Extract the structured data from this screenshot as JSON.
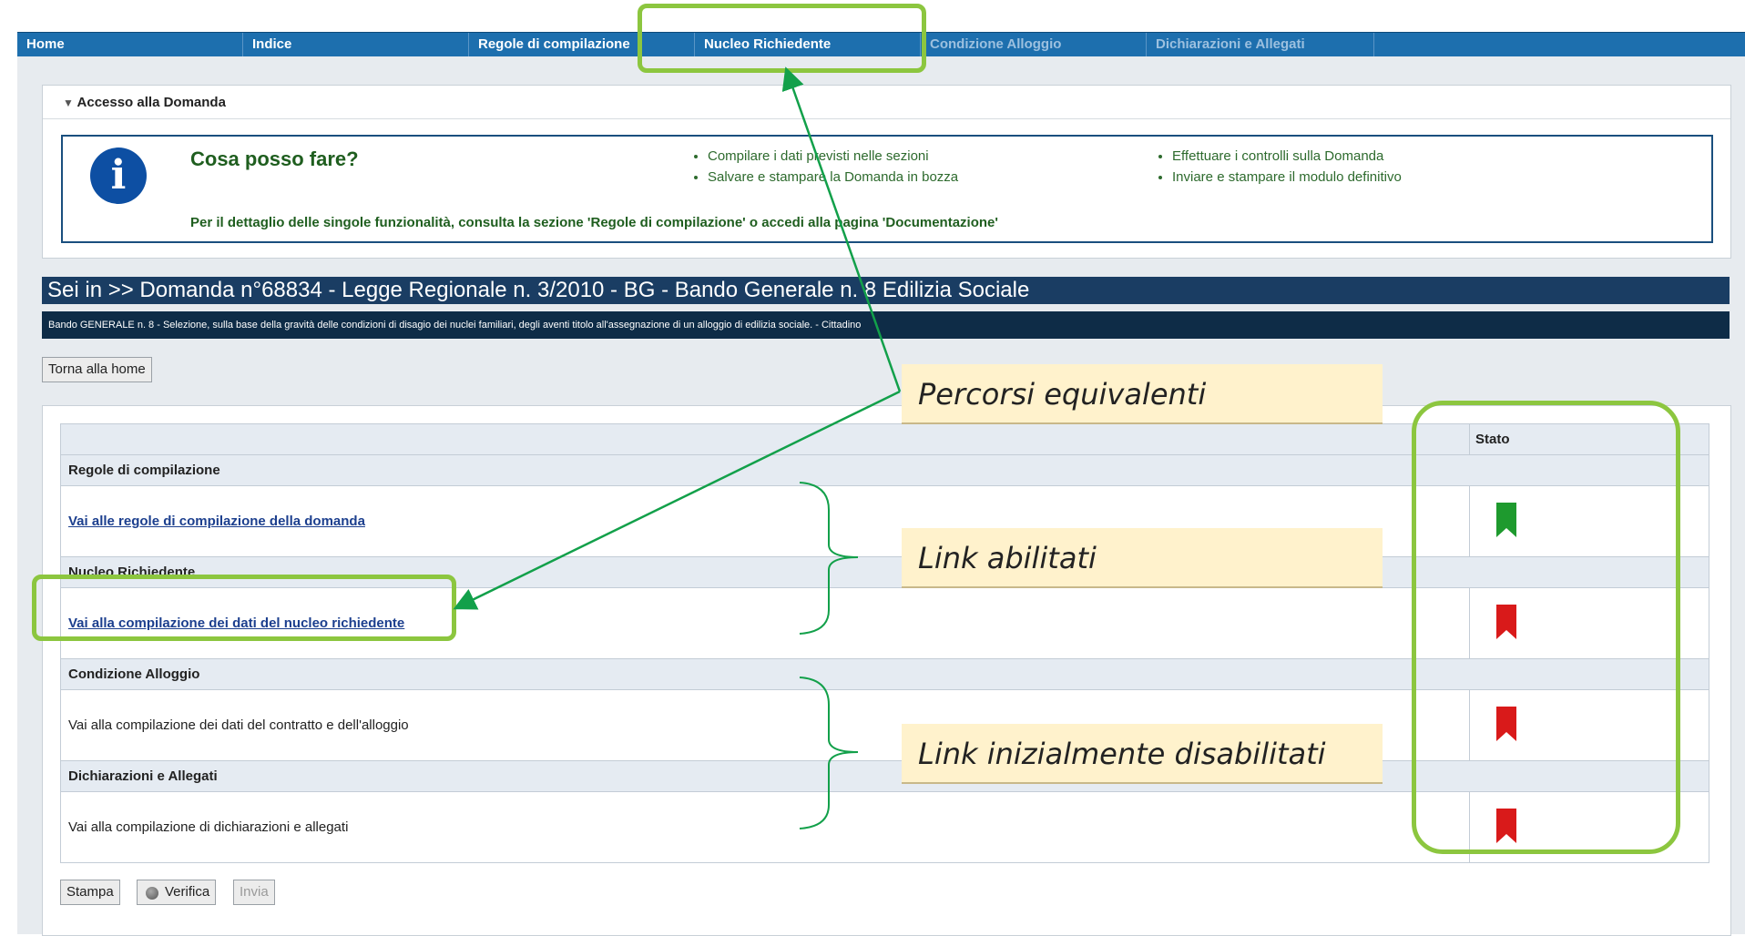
{
  "nav": {
    "tabs": [
      {
        "label": "Home",
        "enabled": true
      },
      {
        "label": "Indice",
        "enabled": true
      },
      {
        "label": "Regole di compilazione",
        "enabled": true
      },
      {
        "label": "Nucleo Richiedente",
        "enabled": true
      },
      {
        "label": "Condizione Alloggio",
        "enabled": false
      },
      {
        "label": "Dichiarazioni e Allegati",
        "enabled": false
      }
    ]
  },
  "access": {
    "header": "Accesso alla Domanda",
    "info_title": "Cosa posso fare?",
    "actions_col1": [
      "Compilare i dati previsti nelle sezioni",
      "Salvare e stampare la Domanda in bozza"
    ],
    "actions_col2": [
      "Effettuare i controlli sulla Domanda",
      "Inviare e stampare il modulo definitivo"
    ],
    "footer": "Per il dettaglio delle singole funzionalità, consulta la sezione 'Regole di compilazione' o accedi alla pagina 'Documentazione'"
  },
  "breadcrumb": "Sei in >> Domanda n°68834 - Legge Regionale n. 3/2010 - BG - Bando Generale n. 8 Edilizia Sociale",
  "subtitle": "Bando GENERALE n. 8 - Selezione, sulla base della gravità delle condizioni di disagio dei nuclei familiari, degli aventi titolo all'assegnazione di un alloggio di edilizia sociale. - Cittadino",
  "home_button": "Torna alla home",
  "table": {
    "stato_header": "Stato",
    "sections": [
      {
        "title": "Regole di compilazione",
        "link": "Vai alle regole di compilazione della domanda",
        "enabled": true,
        "status_color": "#1e9a2e"
      },
      {
        "title": "Nucleo Richiedente",
        "link": "Vai alla compilazione dei dati del nucleo richiedente",
        "enabled": true,
        "status_color": "#d91a1a"
      },
      {
        "title": "Condizione Alloggio",
        "link": "Vai alla compilazione dei dati del contratto e dell'alloggio",
        "enabled": false,
        "status_color": "#d91a1a"
      },
      {
        "title": "Dichiarazioni e Allegati",
        "link": "Vai alla compilazione di dichiarazioni e allegati",
        "enabled": false,
        "status_color": "#d91a1a"
      }
    ]
  },
  "buttons": {
    "stampa": "Stampa",
    "verifica": "Verifica",
    "invia": "Invia"
  },
  "callouts": {
    "percorsi": "Percorsi equivalenti",
    "abilitati": "Link abilitati",
    "disabilitati": "Link inizialmente disabilitati"
  },
  "colors": {
    "highlight": "#8cc63f",
    "arrow": "#12a04a",
    "nav": "#1d6fae",
    "callout_bg": "#fff2cc"
  }
}
